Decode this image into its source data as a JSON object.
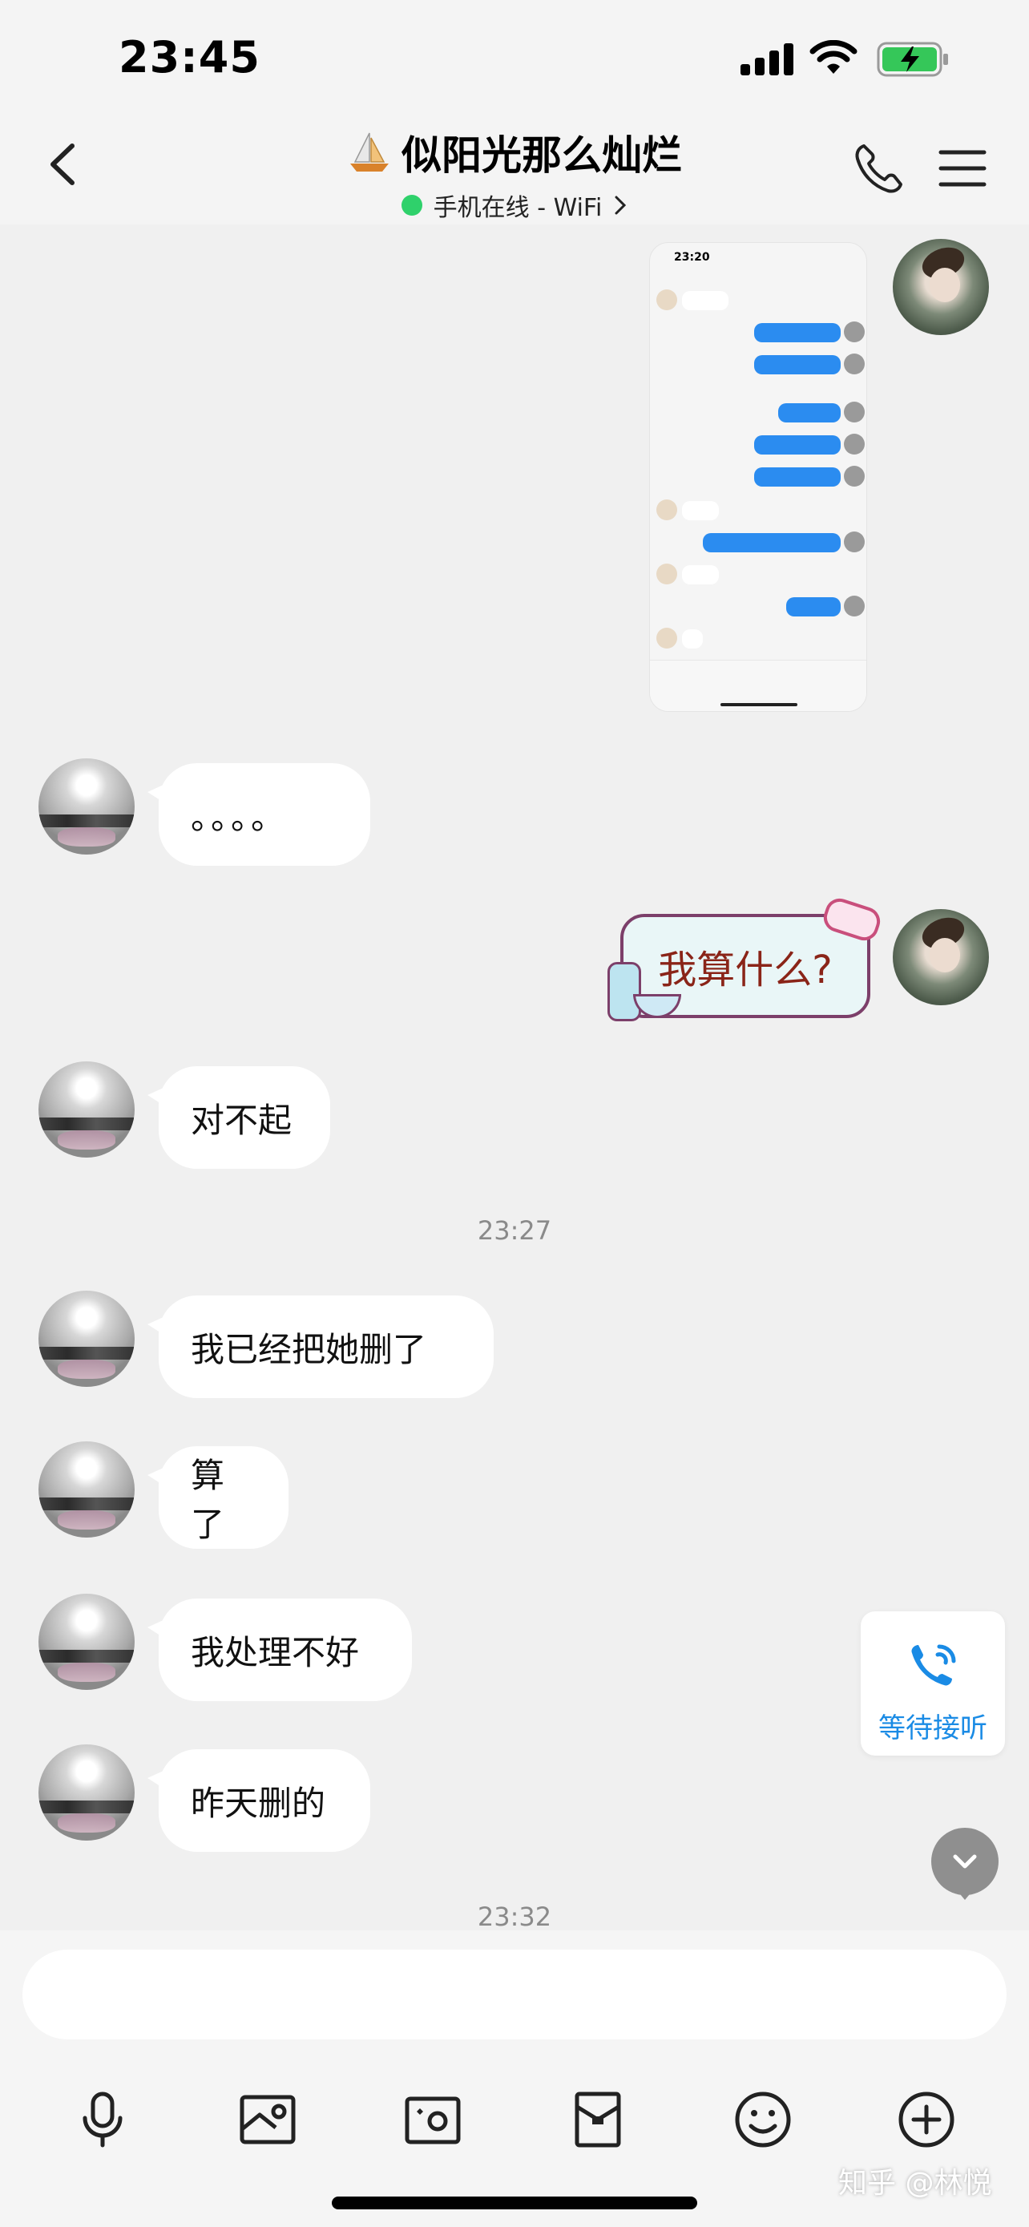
{
  "status_bar": {
    "time": "23:45"
  },
  "header": {
    "title": "似阳光那么灿烂",
    "subtitle": "手机在线 - WiFi",
    "icons": [
      "chevron-left-icon",
      "sailboat-icon",
      "phone-icon",
      "menu-icon"
    ]
  },
  "messages": [
    {
      "from": "me",
      "type": "screenshot",
      "thumb_time": "23:20"
    },
    {
      "from": "them",
      "text": "。。。。"
    },
    {
      "from": "me",
      "type": "sticker",
      "text": "我算什么?"
    },
    {
      "from": "them",
      "text": "对不起"
    },
    {
      "timestamp": "23:27"
    },
    {
      "from": "them",
      "text": "我已经把她删了"
    },
    {
      "from": "them",
      "text": "算了"
    },
    {
      "from": "them",
      "text": "我处理不好"
    },
    {
      "from": "them",
      "text": "昨天删的"
    },
    {
      "timestamp": "23:32"
    }
  ],
  "call_card": {
    "label": "等待接听"
  },
  "input": {
    "placeholder": ""
  },
  "toolbar": [
    "microphone-icon",
    "image-icon",
    "camera-icon",
    "red-packet-icon",
    "emoji-icon",
    "plus-icon"
  ],
  "watermark": "知乎 @林悦",
  "colors": {
    "accent": "#1a8be5",
    "online": "#2fd16b",
    "background": "#f0f0f0",
    "bubble": "#ffffff"
  }
}
